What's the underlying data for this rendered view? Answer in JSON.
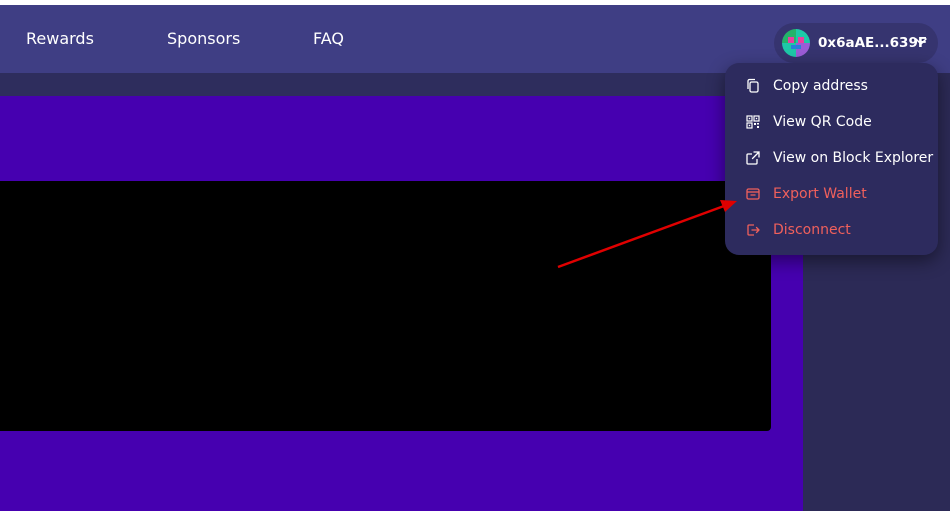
{
  "nav": {
    "links": [
      "Rewards",
      "Sponsors",
      "FAQ"
    ]
  },
  "wallet": {
    "address": "0x6aAE...639F",
    "avatar_icon": "pixel-avatar-icon",
    "chevron_icon": "chevron-down-icon"
  },
  "menu": {
    "items": [
      {
        "label": "Copy address",
        "icon": "copy-icon"
      },
      {
        "label": "View QR Code",
        "icon": "qr-code-icon"
      },
      {
        "label": "View on Block Explorer",
        "icon": "external-link-icon"
      },
      {
        "label": "Export Wallet",
        "icon": "wallet-icon",
        "variant": "danger"
      },
      {
        "label": "Disconnect",
        "icon": "disconnect-icon",
        "variant": "danger"
      }
    ]
  },
  "colors": {
    "navbar": "#3f3e84",
    "panel": "#4600b0",
    "danger": "#f0605c",
    "annotation_arrow": "#e00000"
  }
}
